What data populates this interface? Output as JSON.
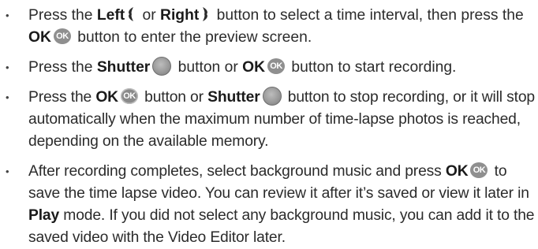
{
  "bullet_char": "•",
  "steps": [
    {
      "seg1": "Press the ",
      "left_label": "Left",
      "seg2": " or ",
      "right_label": "Right",
      "seg3": " button to select a time interval, then press the ",
      "ok_label": "OK",
      "seg4": " button to enter the preview screen."
    },
    {
      "seg1": "Press the ",
      "shutter_label": "Shutter",
      "seg2": " button or ",
      "ok_label": "OK",
      "seg3": " button to start recording."
    },
    {
      "seg1": "Press the ",
      "ok_label": "OK",
      "seg2": " button or ",
      "shutter_label": "Shutter",
      "seg3": " button to stop recording, or it will stop automatically when the maximum number of time-lapse photos is reached, depending on the available memory."
    },
    {
      "seg1": "After recording completes, select background music and press ",
      "ok_label": "OK",
      "seg2": " to save the time lapse video. You can review it after it’s saved or view it later in ",
      "play_label": "Play",
      "seg3": " mode. If you did not select any background music, you can add it to the saved video with the Video Editor later."
    }
  ],
  "icons": {
    "ok_text": "OK",
    "left": "left-arrow-icon",
    "right": "right-arrow-icon",
    "shutter": "shutter-icon",
    "ok": "ok-icon"
  },
  "colors": {
    "text": "#2b2b2b",
    "icon_gray": "#8f8f8f"
  }
}
